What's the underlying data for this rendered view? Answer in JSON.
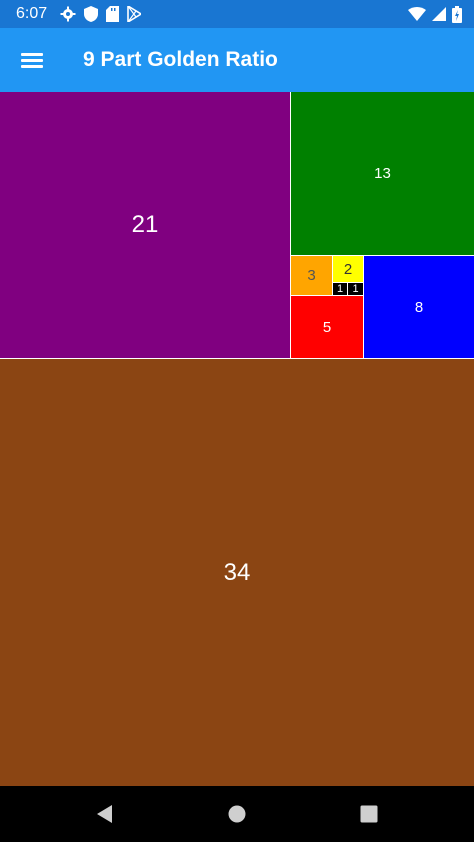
{
  "status_bar": {
    "time": "6:07",
    "icons_left": [
      "settings-icon",
      "shield-icon",
      "sd-card-icon",
      "play-store-icon"
    ],
    "icons_right": [
      "wifi-icon",
      "signal-icon",
      "battery-icon"
    ]
  },
  "app_bar": {
    "menu_icon": "menu-icon",
    "title": "9 Part Golden Ratio",
    "background": "#2196F3"
  },
  "tiles": [
    {
      "label": "21",
      "color": "#800080",
      "text_color": "#ffffff"
    },
    {
      "label": "13",
      "color": "#008000",
      "text_color": "#ffffff"
    },
    {
      "label": "3",
      "color": "#FFA500",
      "text_color": "#555555"
    },
    {
      "label": "2",
      "color": "#FFFF00",
      "text_color": "#333333"
    },
    {
      "label": "1",
      "color": "#000000",
      "text_color": "#ffffff"
    },
    {
      "label": "1",
      "color": "#000000",
      "text_color": "#ffffff"
    },
    {
      "label": "5",
      "color": "#FF0000",
      "text_color": "#ffffff"
    },
    {
      "label": "8",
      "color": "#0000FF",
      "text_color": "#ffffff"
    },
    {
      "label": "34",
      "color": "#8B4513",
      "text_color": "#ffffff"
    }
  ],
  "nav_bar": {
    "buttons": [
      "back-icon",
      "home-icon",
      "recents-icon"
    ]
  }
}
